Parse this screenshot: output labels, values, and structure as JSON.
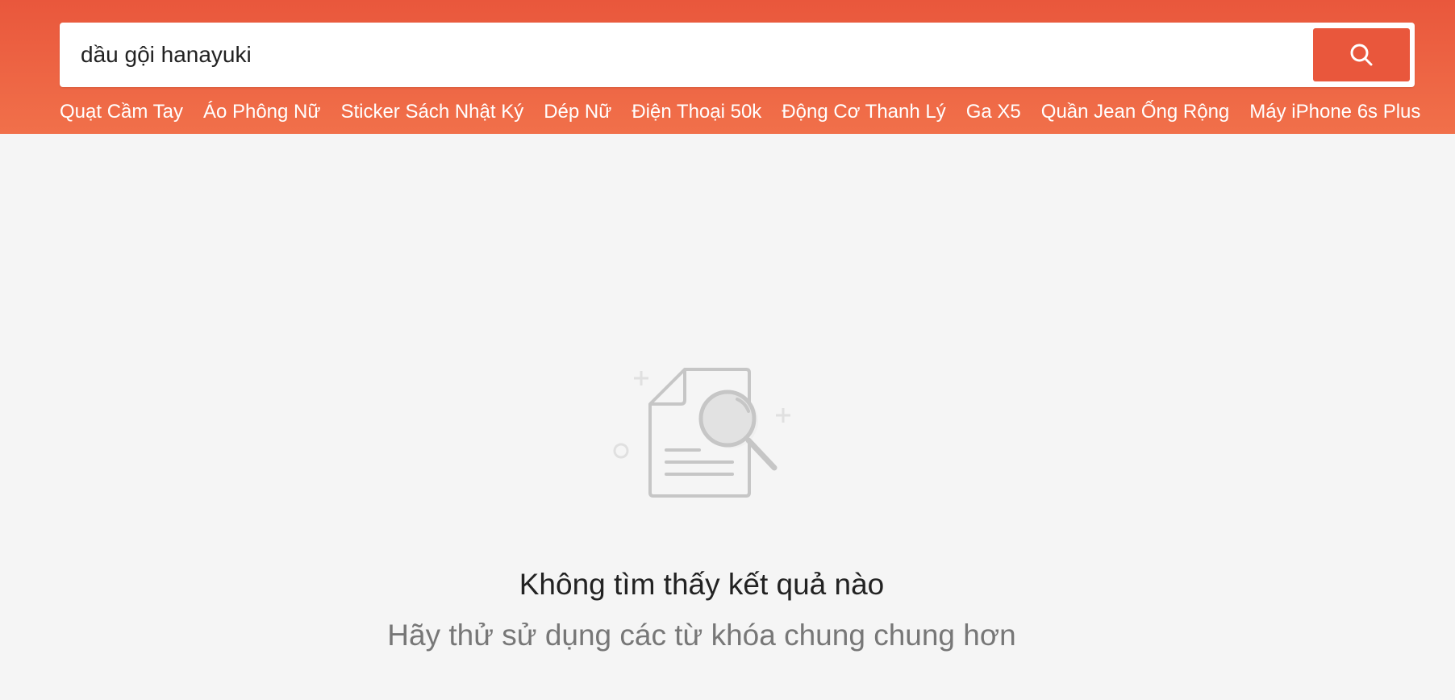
{
  "search": {
    "value": "dầu gội hanayuki",
    "button_icon": "search-icon"
  },
  "keywords": [
    "Quạt Cầm Tay",
    "Áo Phông Nữ",
    "Sticker Sách Nhật Ký",
    "Dép Nữ",
    "Điện Thoại 50k",
    "Động Cơ Thanh Lý",
    "Ga X5",
    "Quần Jean Ống Rộng",
    "Máy iPhone 6s Plus"
  ],
  "empty_state": {
    "icon": "document-search-icon",
    "title": "Không tìm thấy kết quả nào",
    "subtitle": "Hãy thử sử dụng các từ khóa chung chung hơn"
  },
  "colors": {
    "brand": "#ee4d2d",
    "header_top": "#e9573c",
    "header_bottom": "#f1704a",
    "background": "#f5f5f5"
  }
}
